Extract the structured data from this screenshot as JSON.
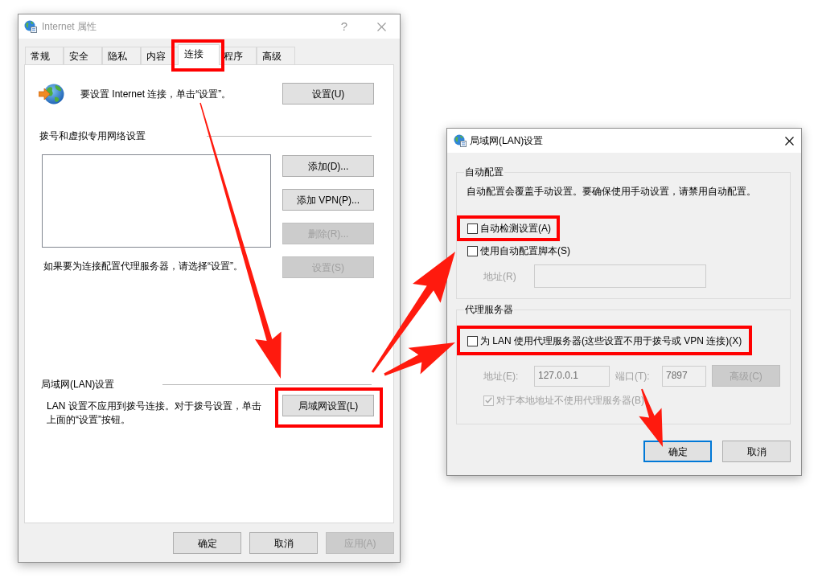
{
  "internet_properties": {
    "title": "Internet 属性",
    "active": false,
    "help_button": "?",
    "tabs": [
      {
        "label": "常规",
        "selected": false
      },
      {
        "label": "安全",
        "selected": false
      },
      {
        "label": "隐私",
        "selected": false
      },
      {
        "label": "内容",
        "selected": false
      },
      {
        "label": "连接",
        "selected": true
      },
      {
        "label": "程序",
        "selected": false
      },
      {
        "label": "高级",
        "selected": false
      }
    ],
    "setup": {
      "text": "要设置 Internet 连接，单击“设置”。",
      "button": {
        "label": "设置(U)",
        "disabled": false
      }
    },
    "dialup_vpn": {
      "heading": "拨号和虚拟专用网络设置",
      "buttons": [
        {
          "label": "添加(D)...",
          "disabled": false
        },
        {
          "label": "添加 VPN(P)...",
          "disabled": false
        },
        {
          "label": "删除(R)...",
          "disabled": true
        },
        {
          "label": "设置(S)",
          "disabled": true
        }
      ],
      "note": "如果要为连接配置代理服务器，请选择“设置”。"
    },
    "lan": {
      "heading": "局域网(LAN)设置",
      "text": "LAN 设置不应用到拨号连接。对于拨号设置，单击上面的“设置”按钮。",
      "button": {
        "label": "局域网设置(L)",
        "disabled": false
      }
    },
    "buttons": [
      {
        "label": "确定",
        "disabled": false
      },
      {
        "label": "取消",
        "disabled": false
      },
      {
        "label": "应用(A)",
        "disabled": true
      }
    ]
  },
  "lan_settings": {
    "title": "局域网(LAN)设置",
    "active": true,
    "auto_config": {
      "legend": "自动配置",
      "description": "自动配置会覆盖手动设置。要确保使用手动设置，请禁用自动配置。",
      "options": [
        {
          "label": "自动检测设置(A)",
          "checked": false,
          "disabled": false
        },
        {
          "label": "使用自动配置脚本(S)",
          "checked": false,
          "disabled": false
        }
      ],
      "address": {
        "label": "地址(R)",
        "disabled": true
      }
    },
    "proxy": {
      "legend": "代理服务器",
      "use_proxy": {
        "label": "为 LAN 使用代理服务器(这些设置不用于拨号或 VPN 连接)(X)",
        "checked": false,
        "disabled": false
      },
      "address": {
        "label": "地址(E):",
        "value": "127.0.0.1",
        "disabled": true
      },
      "port": {
        "label": "端口(T):",
        "value": "7897",
        "disabled": true
      },
      "advanced_button": {
        "label": "高级(C)",
        "disabled": true
      },
      "bypass_local": {
        "label": "对于本地地址不使用代理服务器(B)",
        "checked": true,
        "disabled": true
      }
    },
    "buttons": [
      {
        "label": "确定",
        "disabled": false,
        "default": true
      },
      {
        "label": "取消",
        "disabled": false,
        "default": false
      }
    ]
  }
}
